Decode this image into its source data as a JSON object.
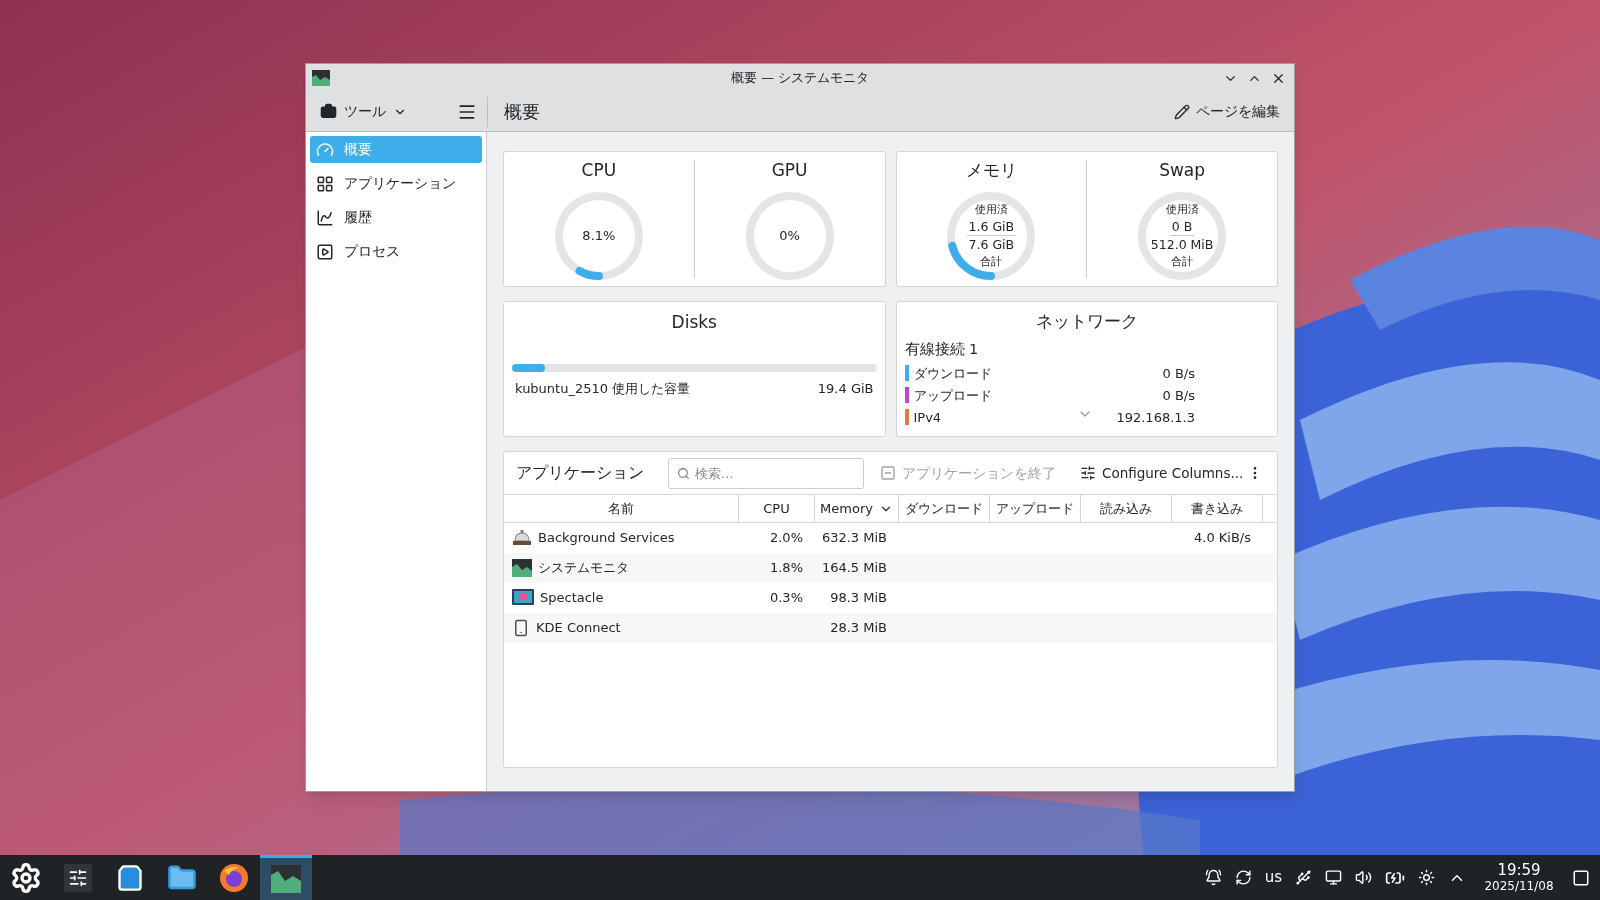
{
  "window": {
    "title": "概要 — システムモニタ"
  },
  "toolbar": {
    "tools_menu": "ツール",
    "page_title": "概要",
    "edit_button": "ページを編集"
  },
  "sidebar": {
    "items": [
      {
        "label": "概要",
        "selected": true
      },
      {
        "label": "アプリケーション",
        "selected": false
      },
      {
        "label": "履歴",
        "selected": false
      },
      {
        "label": "プロセス",
        "selected": false
      }
    ]
  },
  "gauges": [
    {
      "kind": "percent",
      "title": "CPU",
      "value": "8.1%",
      "level": 0.081
    },
    {
      "kind": "percent",
      "title": "GPU",
      "value": "0%",
      "level": 0
    },
    {
      "kind": "usage",
      "title": "メモリ",
      "used_label": "使用済",
      "used": "1.6 GiB",
      "total": "7.6 GiB",
      "total_label": "合計",
      "level": 0.21
    },
    {
      "kind": "usage",
      "title": "Swap",
      "used_label": "使用済",
      "used": "0 B",
      "total": "512.0 MiB",
      "total_label": "合計",
      "level": 0
    }
  ],
  "disks": {
    "title": "Disks",
    "items": [
      {
        "name": "kubuntu_2510 使用した容量",
        "value": "19.4 GiB",
        "level": 0.09
      }
    ]
  },
  "network": {
    "title": "ネットワーク",
    "connection": "有線接続 1",
    "rows": [
      {
        "label": "ダウンロード",
        "value": "0 B/s",
        "color": "#3daee9"
      },
      {
        "label": "アップロード",
        "value": "0 B/s",
        "color": "#c63fdc"
      },
      {
        "label": "IPv4",
        "value": "192.168.1.3",
        "color": "#e8773a"
      }
    ]
  },
  "applications": {
    "title": "アプリケーション",
    "search": {
      "placeholder": "検索..."
    },
    "end_button": {
      "label": "アプリケーションを終了",
      "disabled": true
    },
    "configure_button": "Configure Columns...",
    "columns": [
      {
        "label": "名前",
        "sorted": false
      },
      {
        "label": "CPU",
        "sorted": false
      },
      {
        "label": "Memory",
        "sorted": true
      },
      {
        "label": "ダウンロード",
        "sorted": false
      },
      {
        "label": "アップロード",
        "sorted": false
      },
      {
        "label": "読み込み",
        "sorted": false
      },
      {
        "label": "書き込み",
        "sorted": false
      }
    ],
    "rows": [
      {
        "name": "Background Services",
        "cpu": "2.0%",
        "memory": "632.3 MiB",
        "write": "4.0 KiB/s"
      },
      {
        "name": "システムモニタ",
        "cpu": "1.8%",
        "memory": "164.5 MiB"
      },
      {
        "name": "Spectacle",
        "cpu": "0.3%",
        "memory": "98.3 MiB"
      },
      {
        "name": "KDE Connect",
        "memory": "28.3 MiB"
      }
    ]
  },
  "taskbar": {
    "keyboard_layout": "us",
    "time": "19:59",
    "date": "2025/11/08",
    "tasks": [
      {
        "selected": false
      },
      {
        "selected": false
      },
      {
        "selected": false
      },
      {
        "selected": false
      },
      {
        "selected": false
      },
      {
        "selected": true
      }
    ]
  }
}
